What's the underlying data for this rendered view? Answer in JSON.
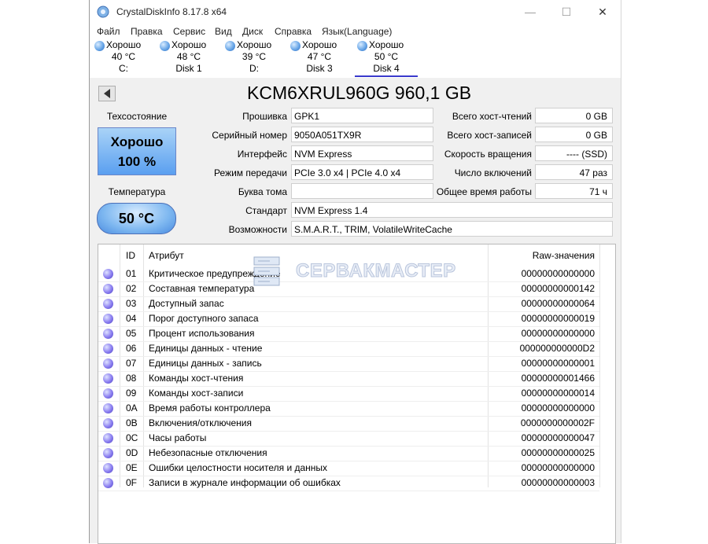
{
  "window": {
    "title": "CrystalDiskInfo 8.17.8 x64",
    "min_glyph": "—",
    "max_glyph": "☐",
    "close_glyph": "✕"
  },
  "menu": [
    "Файл",
    "Правка",
    "Сервис",
    "Вид",
    "Диск",
    "Справка",
    "Язык(Language)"
  ],
  "disks": [
    {
      "status": "Хорошо",
      "temp": "40 °C",
      "label": "C:"
    },
    {
      "status": "Хорошо",
      "temp": "48 °C",
      "label": "Disk 1"
    },
    {
      "status": "Хорошо",
      "temp": "39 °C",
      "label": "D:"
    },
    {
      "status": "Хорошо",
      "temp": "47 °C",
      "label": "Disk 3"
    },
    {
      "status": "Хорошо",
      "temp": "50 °C",
      "label": "Disk 4"
    }
  ],
  "model": "KCM6XRUL960G 960,1 GB",
  "health": {
    "label": "Техсостояние",
    "status": "Хорошо",
    "percent": "100 %"
  },
  "temperature": {
    "label": "Температура",
    "value": "50 °C"
  },
  "fields_left": [
    {
      "label": "Прошивка",
      "value": "GPK1"
    },
    {
      "label": "Серийный номер",
      "value": "9050A051TX9R"
    },
    {
      "label": "Интерфейс",
      "value": "NVM Express"
    },
    {
      "label": "Режим передачи",
      "value": "PCIe 3.0 x4 | PCIe 4.0 x4"
    },
    {
      "label": "Буква тома",
      "value": ""
    }
  ],
  "fields_wide": [
    {
      "label": "Стандарт",
      "value": "NVM Express 1.4"
    },
    {
      "label": "Возможности",
      "value": "S.M.A.R.T., TRIM, VolatileWriteCache"
    }
  ],
  "fields_right": [
    {
      "label": "Всего хост-чтений",
      "value": "0 GB"
    },
    {
      "label": "Всего хост-записей",
      "value": "0 GB"
    },
    {
      "label": "Скорость вращения",
      "value": "---- (SSD)"
    },
    {
      "label": "Число включений",
      "value": "47 раз"
    },
    {
      "label": "Общее время работы",
      "value": "71 ч"
    }
  ],
  "table": {
    "headers": {
      "id": "ID",
      "attr": "Атрибут",
      "raw": "Raw-значения"
    },
    "rows": [
      {
        "id": "01",
        "attr": "Критическое предупреждение",
        "raw": "00000000000000"
      },
      {
        "id": "02",
        "attr": "Составная температура",
        "raw": "00000000000142"
      },
      {
        "id": "03",
        "attr": "Доступный запас",
        "raw": "00000000000064"
      },
      {
        "id": "04",
        "attr": "Порог доступного запаса",
        "raw": "00000000000019"
      },
      {
        "id": "05",
        "attr": "Процент использования",
        "raw": "00000000000000"
      },
      {
        "id": "06",
        "attr": "Единицы данных - чтение",
        "raw": "000000000000D2"
      },
      {
        "id": "07",
        "attr": "Единицы данных - запись",
        "raw": "00000000000001"
      },
      {
        "id": "08",
        "attr": "Команды хост-чтения",
        "raw": "00000000001466"
      },
      {
        "id": "09",
        "attr": "Команды хост-записи",
        "raw": "00000000000014"
      },
      {
        "id": "0A",
        "attr": "Время работы контроллера",
        "raw": "00000000000000"
      },
      {
        "id": "0B",
        "attr": "Включения/отключения",
        "raw": "0000000000002F"
      },
      {
        "id": "0C",
        "attr": "Часы работы",
        "raw": "00000000000047"
      },
      {
        "id": "0D",
        "attr": "Небезопасные отключения",
        "raw": "00000000000025"
      },
      {
        "id": "0E",
        "attr": "Ошибки целостности носителя и данных",
        "raw": "00000000000000"
      },
      {
        "id": "0F",
        "attr": "Записи в журнале информации об ошибках",
        "raw": "00000000000003"
      }
    ]
  },
  "watermark": "СЕРВАКМАСТЕР"
}
